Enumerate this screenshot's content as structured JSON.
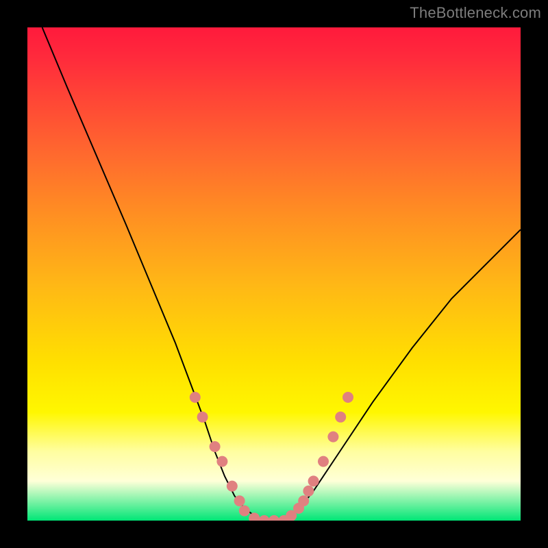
{
  "watermark": "TheBottleneck.com",
  "chart_data": {
    "type": "line",
    "title": "",
    "xlabel": "",
    "ylabel": "",
    "xlim": [
      0,
      100
    ],
    "ylim": [
      0,
      100
    ],
    "grid": false,
    "legend": false,
    "background_gradient": {
      "top_color": "#ff1a3c",
      "mid_color": "#ffe000",
      "bottom_color": "#00e676",
      "meaning": "top=red=high bottleneck, bottom=green=no bottleneck"
    },
    "series": [
      {
        "name": "left-curve",
        "stroke": "#000000",
        "x": [
          3,
          8,
          14,
          20,
          25,
          30,
          33,
          36,
          38,
          40,
          42,
          44,
          46,
          48
        ],
        "y": [
          100,
          88,
          74,
          60,
          48,
          36,
          28,
          20,
          14,
          9,
          5,
          2.5,
          1,
          0
        ]
      },
      {
        "name": "right-curve",
        "stroke": "#000000",
        "x": [
          52,
          54,
          56,
          58,
          60,
          64,
          70,
          78,
          86,
          94,
          100
        ],
        "y": [
          0,
          1.5,
          3.5,
          6,
          9,
          15,
          24,
          35,
          45,
          53,
          59
        ]
      },
      {
        "name": "green-band-top",
        "stroke": "#00e676",
        "x": [
          0,
          100
        ],
        "y": [
          3.5,
          3.5
        ]
      }
    ],
    "markers": {
      "name": "highlight-dots",
      "shape": "circle",
      "color": "#e08080",
      "radius_px": 8,
      "points": [
        {
          "x": 34,
          "y": 25
        },
        {
          "x": 35.5,
          "y": 21
        },
        {
          "x": 38,
          "y": 15
        },
        {
          "x": 39.5,
          "y": 12
        },
        {
          "x": 41.5,
          "y": 7
        },
        {
          "x": 43,
          "y": 4
        },
        {
          "x": 44,
          "y": 2
        },
        {
          "x": 46,
          "y": 0.5
        },
        {
          "x": 48,
          "y": 0
        },
        {
          "x": 50,
          "y": 0
        },
        {
          "x": 52,
          "y": 0
        },
        {
          "x": 53.5,
          "y": 1
        },
        {
          "x": 55,
          "y": 2.5
        },
        {
          "x": 56,
          "y": 4
        },
        {
          "x": 57,
          "y": 6
        },
        {
          "x": 58,
          "y": 8
        },
        {
          "x": 60,
          "y": 12
        },
        {
          "x": 62,
          "y": 17
        },
        {
          "x": 63.5,
          "y": 21
        },
        {
          "x": 65,
          "y": 25
        }
      ]
    }
  }
}
